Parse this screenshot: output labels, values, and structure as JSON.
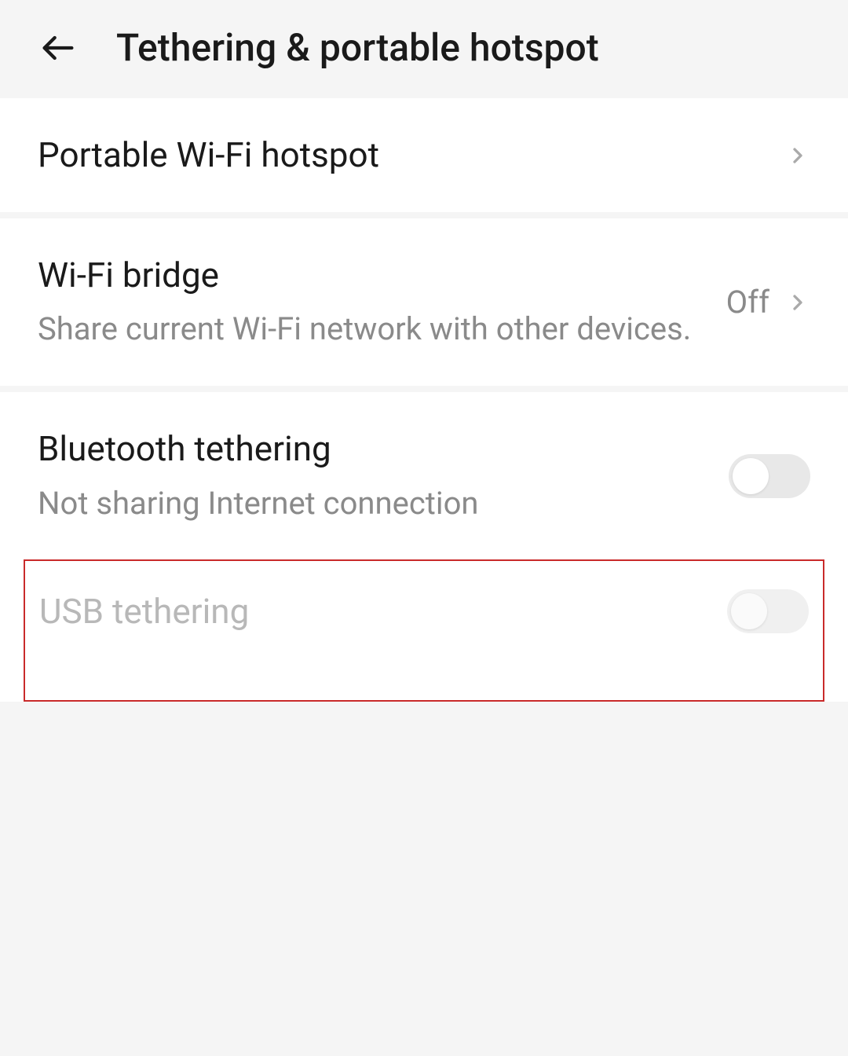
{
  "header": {
    "title": "Tethering & portable hotspot"
  },
  "rows": {
    "wifi_hotspot": {
      "title": "Portable Wi-Fi hotspot"
    },
    "wifi_bridge": {
      "title": "Wi-Fi bridge",
      "subtitle": "Share current Wi-Fi network with other devices.",
      "status": "Off"
    },
    "bluetooth_tethering": {
      "title": "Bluetooth tethering",
      "subtitle": "Not sharing Internet connection"
    },
    "usb_tethering": {
      "title": "USB tethering"
    }
  }
}
